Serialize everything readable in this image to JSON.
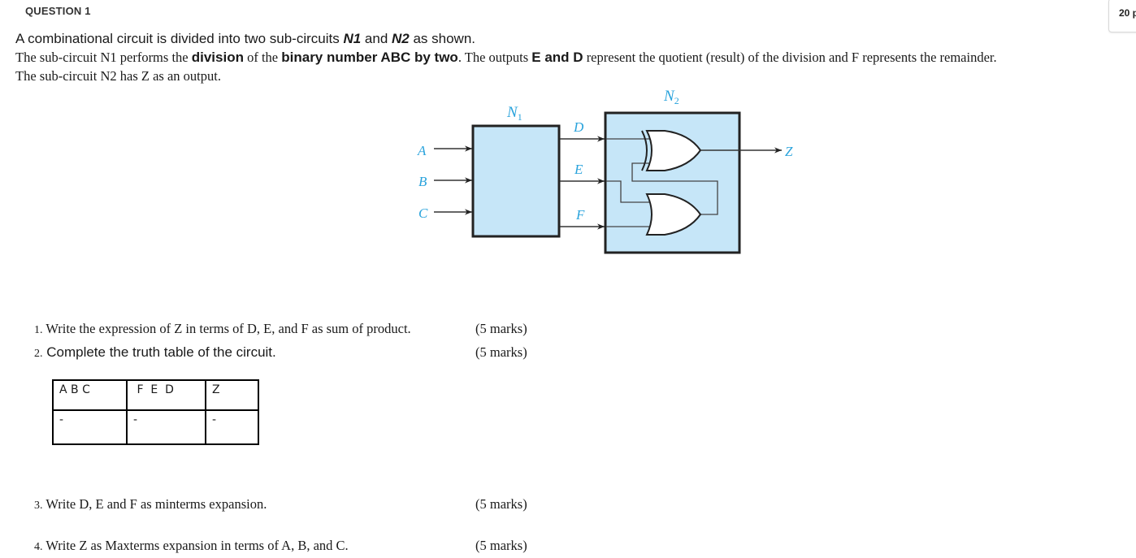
{
  "question": {
    "title": "QUESTION 1",
    "points_badge": "20 p"
  },
  "intro": {
    "line1_a": "A combinational circuit is divided into two sub-circuits ",
    "line1_n1": "N1",
    "line1_b": " and ",
    "line1_n2": "N2",
    "line1_c": " as shown.",
    "line2_a": "The sub-circuit N1 performs the ",
    "line2_division": "division",
    "line2_b": " of the ",
    "line2_binary": "binary number ABC by two",
    "line2_c": ". The outputs  ",
    "line2_ed": "E and D",
    "line2_d": " represent the quotient  (result) of the division and F represents the remainder.",
    "line3": "The sub-circuit N2 has Z as an output."
  },
  "circuit": {
    "n1_label": "N",
    "n1_sub": "1",
    "n2_label": "N",
    "n2_sub": "2",
    "inputs": [
      "A",
      "B",
      "C"
    ],
    "n1_outputs": [
      "D",
      "E",
      "F"
    ],
    "output": "Z",
    "gates": [
      "xor-gate",
      "or-gate"
    ],
    "colors": {
      "fill": "#c6e6f8",
      "label": "#2aa3dc",
      "stroke": "#222222"
    }
  },
  "questions": [
    {
      "num": "1.",
      "text": " Write the expression of Z in terms of D, E, and F as sum of product.",
      "marks": "(5 marks)"
    },
    {
      "num": "2.",
      "text": " Complete  the truth table of the circuit.",
      "marks": "(5 marks)"
    },
    {
      "num": "3.",
      "text": " Write D, E and F as minterms expansion.",
      "marks": "(5 marks)"
    },
    {
      "num": "4.",
      "text": " Write Z as Maxterms  expansion  in terms of A, B, and C.",
      "marks": "(5 marks)"
    }
  ],
  "truth_table": {
    "headers": [
      "A B C",
      " F  E  D",
      "Z"
    ],
    "rows": [
      [
        "-",
        "-",
        "-"
      ]
    ]
  }
}
